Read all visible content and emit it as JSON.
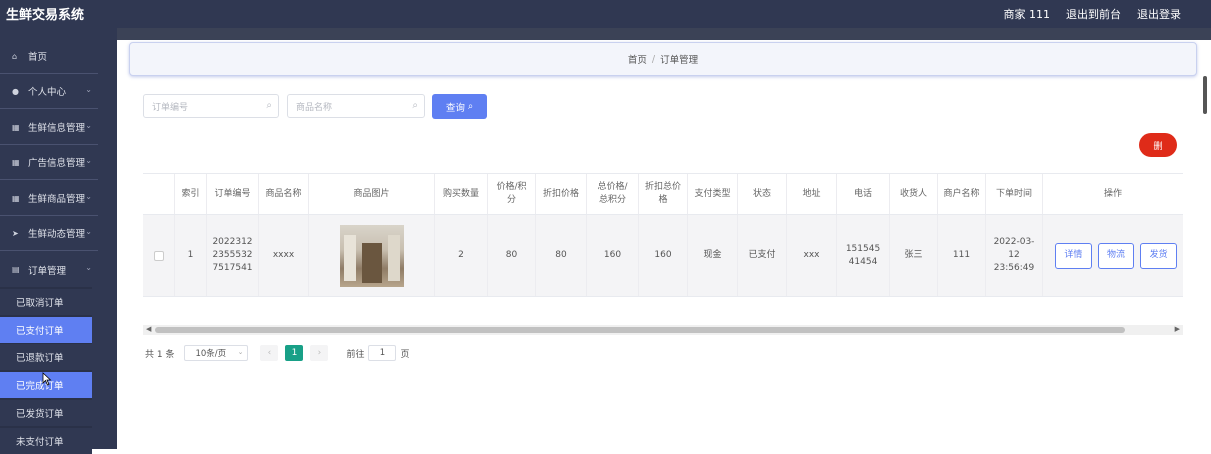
{
  "app": {
    "title": "生鲜交易系统"
  },
  "topbar": {
    "user": "商家 111",
    "back_front": "退出到前台",
    "logout": "退出登录"
  },
  "sidebar": {
    "items": [
      {
        "label": "首页",
        "icon": "home-icon"
      },
      {
        "label": "个人中心",
        "icon": "user-icon"
      },
      {
        "label": "生鲜信息管理",
        "icon": "grid-icon"
      },
      {
        "label": "广告信息管理",
        "icon": "grid-icon"
      },
      {
        "label": "生鲜商品管理",
        "icon": "grid-icon"
      },
      {
        "label": "生鲜动态管理",
        "icon": "send-icon"
      },
      {
        "label": "订单管理",
        "icon": "document-icon"
      }
    ],
    "sub_items": [
      {
        "label": "已取消订单"
      },
      {
        "label": "已支付订单"
      },
      {
        "label": "已退款订单"
      },
      {
        "label": "已完成订单"
      },
      {
        "label": "已发货订单"
      },
      {
        "label": "未支付订单"
      }
    ]
  },
  "breadcrumb": {
    "home": "首页",
    "separator": "/",
    "current": "订单管理"
  },
  "search": {
    "order_no_placeholder": "订单编号",
    "product_name_placeholder": "商品名称",
    "query_label": "查询"
  },
  "action": {
    "red_button": "删"
  },
  "table": {
    "headers": [
      "",
      "索引",
      "订单编号",
      "商品名称",
      "商品图片",
      "购买数量",
      "价格/积分",
      "折扣价格",
      "总价格/总积分",
      "折扣总价格",
      "支付类型",
      "状态",
      "地址",
      "电话",
      "收货人",
      "商户名称",
      "下单时间",
      "操作"
    ],
    "row": {
      "index": "1",
      "order_no": "202231223555327517541",
      "product_name": "xxxx",
      "quantity": "2",
      "price": "80",
      "discount_price": "80",
      "total": "160",
      "discount_total": "160",
      "pay_type": "现金",
      "status": "已支付",
      "address": "xxx",
      "phone": "15154541454",
      "receiver": "张三",
      "merchant": "111",
      "time": "2022-03-12 23:56:49",
      "ops": [
        "详情",
        "物流",
        "发货"
      ]
    }
  },
  "pagination": {
    "total": "共 1 条",
    "page_size": "10条/页",
    "current": "1",
    "goto_prefix": "前往",
    "goto_value": "1",
    "goto_suffix": "页"
  },
  "colors": {
    "sidebar": "#303852",
    "primary": "#5f7ff2",
    "danger": "#df2b19",
    "pager_active": "#18a087"
  }
}
